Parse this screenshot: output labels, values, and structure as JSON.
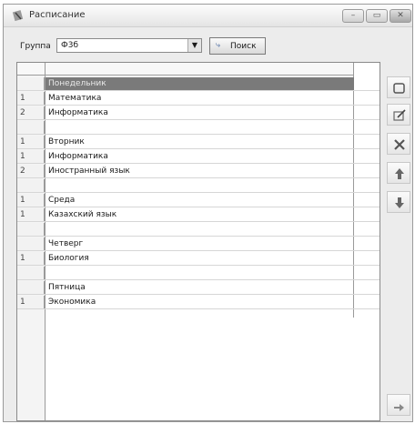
{
  "window": {
    "title": "Расписание"
  },
  "filter": {
    "group_label": "Группа",
    "group_value": "Ф3б",
    "search_label": "Поиск"
  },
  "schedule": [
    {
      "num": "",
      "text": "Понедельник",
      "selected": true
    },
    {
      "num": "1",
      "text": "Математика"
    },
    {
      "num": "2",
      "text": "Информатика"
    },
    {
      "num": "",
      "text": ""
    },
    {
      "num": "1",
      "text": "Вторник"
    },
    {
      "num": "1",
      "text": "Информатика"
    },
    {
      "num": "2",
      "text": "Иностранный язык"
    },
    {
      "num": "",
      "text": ""
    },
    {
      "num": "1",
      "text": "Среда"
    },
    {
      "num": "1",
      "text": "Казахский язык"
    },
    {
      "num": "",
      "text": ""
    },
    {
      "num": "",
      "text": "Четверг"
    },
    {
      "num": "1",
      "text": "Биология"
    },
    {
      "num": "",
      "text": ""
    },
    {
      "num": "",
      "text": "Пятница"
    },
    {
      "num": "1",
      "text": "Экономика"
    }
  ],
  "toolbar": {
    "icons": [
      "new-icon",
      "edit-icon",
      "delete-icon",
      "move-up-icon",
      "move-down-icon",
      "exit-icon"
    ]
  }
}
